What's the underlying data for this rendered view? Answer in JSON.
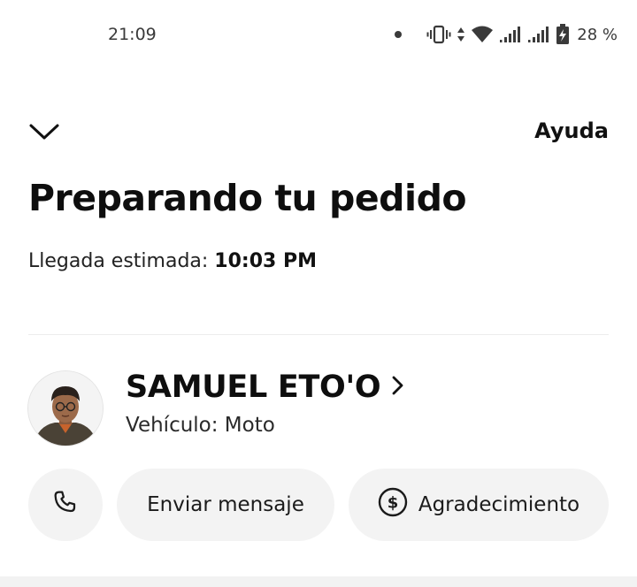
{
  "status_bar": {
    "time": "21:09",
    "battery_percent": "28 %",
    "icons": [
      "notification-dot-icon",
      "vibrate-icon",
      "data-arrows-icon",
      "wifi-icon",
      "signal-icon",
      "signal-icon",
      "battery-charging-icon"
    ]
  },
  "header": {
    "back_icon": "chevron-down-icon",
    "help_label": "Ayuda"
  },
  "order": {
    "title": "Preparando tu pedido",
    "eta_label": "Llegada estimada:",
    "eta_value": "10:03 PM"
  },
  "courier": {
    "name": "SAMUEL ETO'O",
    "vehicle": "Vehículo: Moto",
    "avatar_icon": "courier-avatar",
    "chevron_icon": "chevron-right-icon"
  },
  "actions": {
    "call_icon": "phone-icon",
    "message_label": "Enviar mensaje",
    "thanks_label": "Agradecimiento",
    "thanks_icon": "dollar-icon"
  },
  "colors": {
    "text_primary": "#111111",
    "pill_background": "#f3f3f3",
    "divider": "#ececec"
  }
}
